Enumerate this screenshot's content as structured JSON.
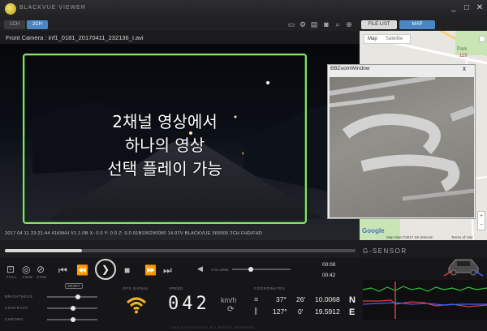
{
  "app": {
    "title": "BLACKVUE VIEWER"
  },
  "window_controls": {
    "minimize": "_",
    "maximize": "□",
    "close": "✕"
  },
  "channels": [
    {
      "label": "1CH"
    },
    {
      "label": "2CH"
    }
  ],
  "tabs": {
    "file_list": "FILE LIST",
    "map": "MAP"
  },
  "camera": {
    "label": "Front Camera :  inf1_0181_20170411_232136_I.avi"
  },
  "overlay": {
    "lines": [
      "2채널 영상에서",
      "하나의 영상",
      "선택 플레이 가능"
    ]
  },
  "osd": {
    "text": "2017 04 11 23:21:44   41KM/H V1.1.0B    X: 0.0 Y: 0.0 Z: 0.0 01B100290000 14.07V BLACKVUE  365500  2CH FHD/FHD"
  },
  "map": {
    "type_map": "Map",
    "type_satellite": "Satellite",
    "park_label": "Park",
    "label_119": "119",
    "google": "Google",
    "copyright": "Map data ©2017 SK telecom",
    "terms": "Terms of Use"
  },
  "zoom_window": {
    "title": "BBZoomWindow",
    "close": "x"
  },
  "gsensor": {
    "label": "G-SENSOR"
  },
  "controls": {
    "mode_labels": [
      "FULL",
      "VIEW",
      "HIDE"
    ],
    "reset": "RESET",
    "volume": "VOLUME",
    "time_current": "00:08",
    "time_total": "00:42",
    "volume_level": 0.32,
    "seek_progress": 0.22
  },
  "adjust": {
    "brightness": "BRIGHTNESS",
    "contrast": "CONTRAST",
    "chroma": "CHROMA",
    "values": [
      0.62,
      0.52,
      0.52
    ]
  },
  "gps": {
    "label": "GPS SIGNAL"
  },
  "speed": {
    "label": "SPEED",
    "value": "042",
    "unit": "km/h"
  },
  "coordinates": {
    "label": "COORDINATES",
    "lat_deg": "37°",
    "lat_min": "26'",
    "lat_sec": "10.0068",
    "lat_dir": "N",
    "lon_deg": "127°",
    "lon_min": "0'",
    "lon_sec": "19.5912",
    "lon_dir": "E"
  },
  "footer": {
    "text": "2016 (C) PITTASOFT ALL RIGHTS RESERVED"
  },
  "colors": {
    "accent": "#4a86c5",
    "overlay_border": "#8fdc6e",
    "graph_red": "#e23c3c",
    "graph_green": "#35c23a",
    "graph_blue": "#4a5cf0"
  }
}
